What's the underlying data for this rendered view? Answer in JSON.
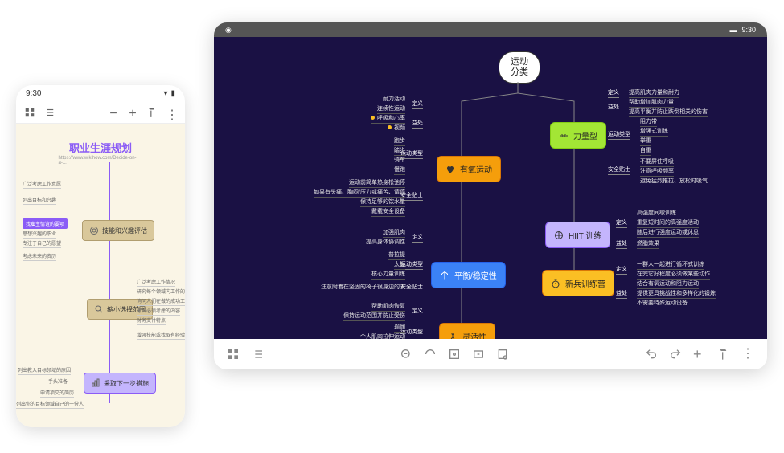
{
  "phone": {
    "status_time": "9:30",
    "title": "职业生涯规划",
    "subtitle": "https://www.wikihow.com/Decide-on-a-...",
    "node1": "技能和兴趣评估",
    "node2": "缩小选择范围",
    "node3": "采取下一步措施",
    "leaves_1": [
      "广泛考虑工作意愿",
      "列出目标和兴趣",
      "找雇主情谊的要项",
      "思想兴趣的职业",
      "专注于自己的愿望",
      "考虑未来的资历"
    ],
    "leaves_2": [
      "广泛考虑工作情况",
      "研究每个领域内工作的多样性",
      "询问人们在做的成功工作",
      "考试必须考虑的内容",
      "财务支付特点",
      "增强技能或找取有经验类的途径"
    ],
    "leaves_3": [
      "列出教入目标领域的原因",
      "手头准备",
      "申请项交的简历",
      "列出你的目标领域自己的一份人"
    ]
  },
  "tablet": {
    "status_time": "9:30",
    "root": "运动\n分类",
    "branches": {
      "aerobic": "有氧运动",
      "strength": "力量型",
      "hiit": "HIIT 训练",
      "bootcamp": "新兵训练营",
      "balance": "平衡/稳定性",
      "flexibility": "灵活性"
    },
    "aerobic_def": [
      "耐力活动",
      "连续性运动"
    ],
    "aerobic_benefit_label": "益处",
    "aerobic_benefit": [
      "呼吸和心率",
      "视频"
    ],
    "aerobic_types_label": "运动类型",
    "aerobic_types": [
      "跑步",
      "踏步",
      "骑车",
      "慢跑"
    ],
    "aerobic_safety_label": "安全贴士",
    "aerobic_safety": [
      "运动前简单热身松弛停",
      "如果有头痛、胸闷/压力或痛苦、请停",
      "保持足够的饮水量",
      "戴载安全设备"
    ],
    "strength_def_label": "定义",
    "strength_def": "提高肌肉力量和耐力",
    "strength_benefit_label": "益处",
    "strength_benefit": [
      "帮助增加肌肉力量",
      "提高平衡并防止跌倒相关的伤害"
    ],
    "strength_types_label": "运动类型",
    "strength_types": [
      "阻力带",
      "增强式训练",
      "举重",
      "自重"
    ],
    "strength_safety_label": "安全贴士",
    "strength_safety": [
      "不要屏住呼吸",
      "注意呼吸频率",
      "避免猛烈推拉、放松时吸气"
    ],
    "hiit_def_label": "定义",
    "hiit_def": [
      "高强度间歇训练",
      "重复短时间的高强度活动",
      "随后进行强度运动或休息"
    ],
    "hiit_benefit_label": "益处",
    "hiit_benefit": "燃脂效果",
    "bootcamp_def_label": "定义",
    "bootcamp_def": [
      "一群人一起进行循环式训练",
      "在完它好程度必须做某些动作"
    ],
    "bootcamp_benefit_label": "益处",
    "bootcamp_benefit": [
      "结合有氧运动和阻力运动",
      "提供更具挑战性和多样化的锻炼",
      "不需要特殊运动设备"
    ],
    "balance_def_label": "定义",
    "balance_def": [
      "加强肌肉",
      "提高身体协调性"
    ],
    "balance_types_label": "运动类型",
    "balance_types": [
      "普拉提",
      "太极",
      "核心力量训练"
    ],
    "balance_safety_label": "安全贴士",
    "balance_safety": "注意附着在坚固的椅子很身边的人",
    "flex_def_label": "定义",
    "flex_def": [
      "帮助肌肉恢复",
      "保持运动范围并防止受伤"
    ],
    "flex_types_label": "运动类型",
    "flex_types": [
      "瑜伽",
      "个人肌肉拉伸运动"
    ],
    "def_label": "定义"
  }
}
